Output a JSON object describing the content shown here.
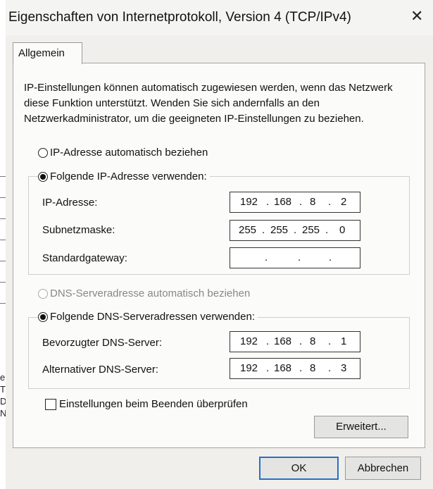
{
  "window": {
    "title": "Eigenschaften von Internetprotokoll, Version 4 (TCP/IPv4)",
    "close_glyph": "✕"
  },
  "tabs": [
    {
      "label": "Allgemein",
      "selected": true
    }
  ],
  "intro_text": "IP-Einstellungen können automatisch zugewiesen werden, wenn das Netzwerk diese Funktion unterstützt. Wenden Sie sich andernfalls an den Netzwerkadministrator, um die geeigneten IP-Einstellungen zu beziehen.",
  "ip_mode": {
    "auto_label": "IP-Adresse automatisch beziehen",
    "manual_label": "Folgende IP-Adresse verwenden:",
    "selected": "manual"
  },
  "ip_fields": {
    "address": {
      "label": "IP-Adresse:",
      "octets": [
        "192",
        "168",
        "8",
        "2"
      ]
    },
    "subnet": {
      "label": "Subnetzmaske:",
      "octets": [
        "255",
        "255",
        "255",
        "0"
      ]
    },
    "gateway": {
      "label": "Standardgateway:",
      "octets": [
        "",
        "",
        "",
        ""
      ]
    }
  },
  "dns_mode": {
    "auto_label": "DNS-Serveradresse automatisch beziehen",
    "manual_label": "Folgende DNS-Serveradressen verwenden:",
    "selected": "manual",
    "auto_disabled": true
  },
  "dns_fields": {
    "preferred": {
      "label": "Bevorzugter DNS-Server:",
      "octets": [
        "192",
        "168",
        "8",
        "1"
      ]
    },
    "alternate": {
      "label": "Alternativer DNS-Server:",
      "octets": [
        "192",
        "168",
        "8",
        "3"
      ]
    }
  },
  "validate": {
    "label": "Einstellungen beim Beenden überprüfen",
    "checked": false
  },
  "buttons": {
    "advanced": "Erweitert...",
    "ok": "OK",
    "cancel": "Abbrechen"
  },
  "dot": ".",
  "background_window": {
    "visible_letters": [
      "e",
      "T",
      "D",
      "N"
    ]
  },
  "colors": {
    "default_button_border": "#2a6fc9",
    "dialog_bg": "#f0efec",
    "panel_bg": "#fbfbfa"
  }
}
